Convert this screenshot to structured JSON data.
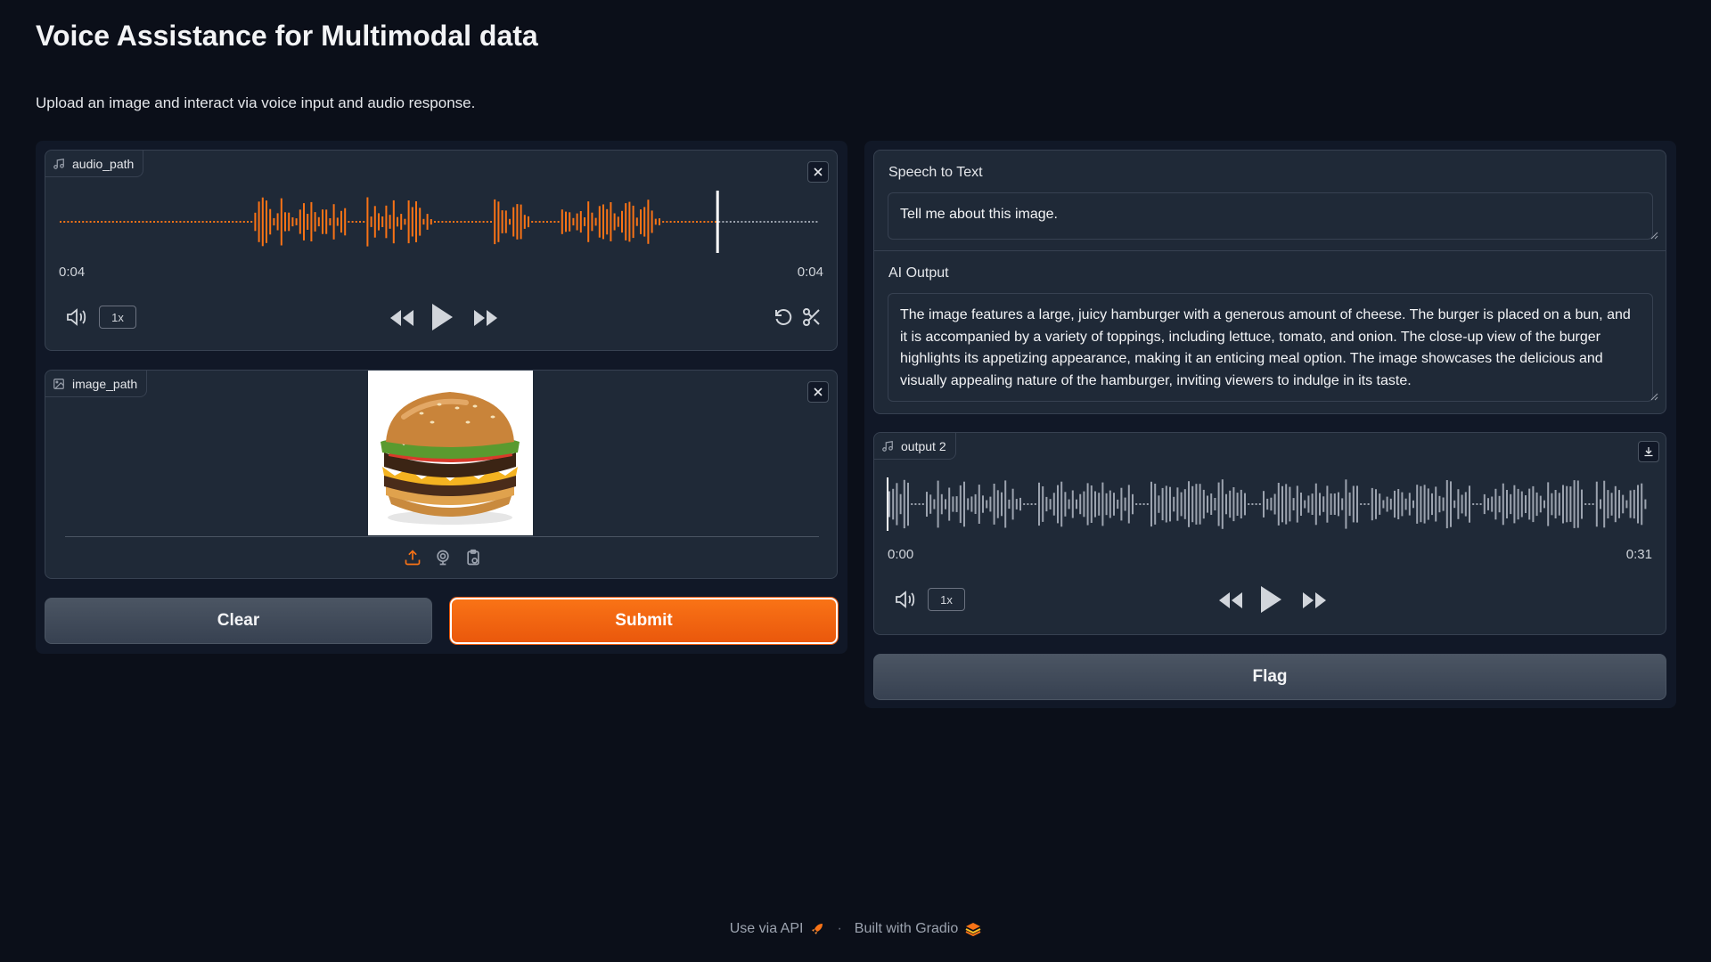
{
  "page": {
    "title": "Voice Assistance for Multimodal data",
    "subtitle": "Upload an image and interact via voice input and audio response."
  },
  "audio_input": {
    "label": "audio_path",
    "current_time": "0:04",
    "duration": "0:04",
    "speed": "1x",
    "accent_color": "#f97316",
    "playhead_fraction": 0.863
  },
  "image_input": {
    "label": "image_path",
    "icons": [
      "upload-icon",
      "webcam-icon",
      "clipboard-icon"
    ]
  },
  "buttons": {
    "clear": "Clear",
    "submit": "Submit",
    "flag": "Flag"
  },
  "speech_to_text": {
    "label": "Speech to Text",
    "value": "Tell me about this image."
  },
  "ai_output": {
    "label": "AI Output",
    "value": "The image features a large, juicy hamburger with a generous amount of cheese. The burger is placed on a bun, and it is accompanied by a variety of toppings, including lettuce, tomato, and onion. The close-up view of the burger highlights its appetizing appearance, making it an enticing meal option. The image showcases the delicious and visually appealing nature of the hamburger, inviting viewers to indulge in its taste."
  },
  "audio_output": {
    "label": "output 2",
    "current_time": "0:00",
    "duration": "0:31",
    "speed": "1x",
    "wave_color": "#9ca3af"
  },
  "footer": {
    "api_link": "Use via API",
    "separator": "·",
    "built_with": "Built with Gradio"
  }
}
